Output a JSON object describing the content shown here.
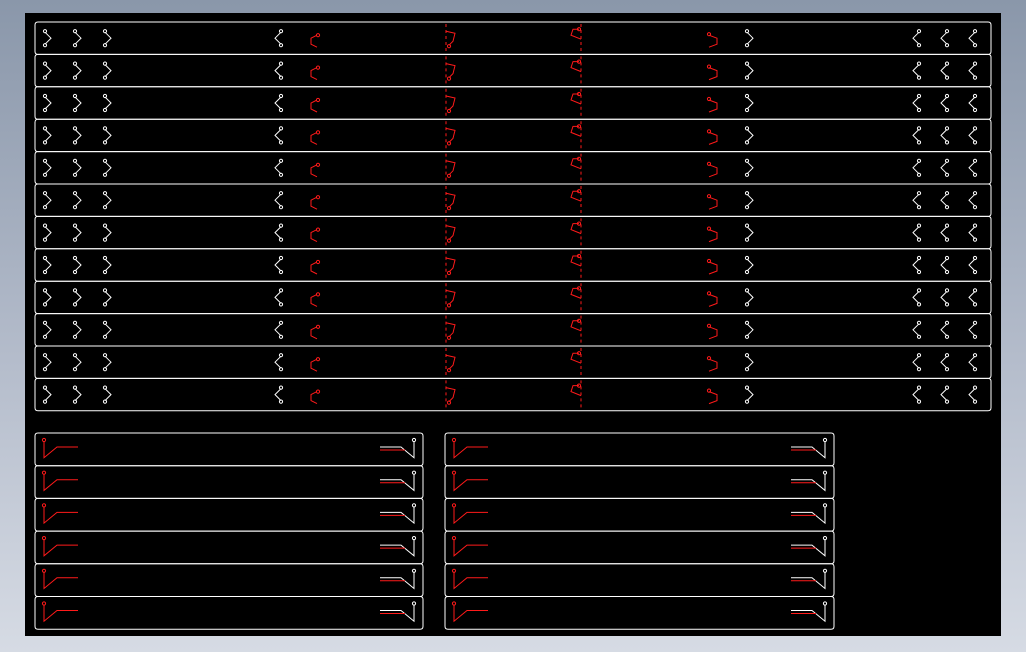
{
  "viewport": {
    "background": "#000000"
  },
  "colors": {
    "outline": "#ffffff",
    "detail": "#ff1a1a"
  },
  "top_panel": {
    "row_count": 12
  },
  "bottom_left_panel": {
    "row_count": 6
  },
  "bottom_right_panel": {
    "row_count": 6
  }
}
